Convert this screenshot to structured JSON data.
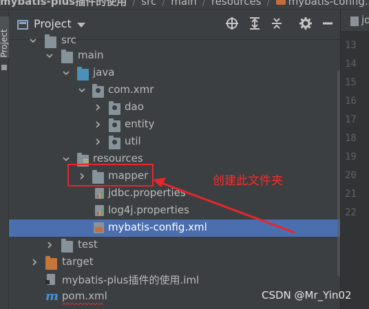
{
  "breadcrumb": {
    "project": "mybatis-plus插件的使用",
    "items": [
      "src",
      "main",
      "resources"
    ],
    "file": "mybatis-config.xml"
  },
  "toolstrip": {
    "project_tab": "Project"
  },
  "panel": {
    "title": "Project",
    "toolbar_icons": [
      "locate-icon",
      "expand-all-icon",
      "collapse-all-icon",
      "gear-icon",
      "hide-icon"
    ]
  },
  "tree": [
    {
      "label": "src",
      "type": "folder",
      "expanded": true
    },
    {
      "label": "main",
      "type": "folder",
      "expanded": true
    },
    {
      "label": "java",
      "type": "source-folder",
      "expanded": true
    },
    {
      "label": "com.xmr",
      "type": "package",
      "expanded": true
    },
    {
      "label": "dao",
      "type": "package",
      "expanded": false
    },
    {
      "label": "entity",
      "type": "package",
      "expanded": false
    },
    {
      "label": "util",
      "type": "package",
      "expanded": false
    },
    {
      "label": "resources",
      "type": "resources-folder",
      "expanded": true
    },
    {
      "label": "mapper",
      "type": "folder",
      "expanded": false
    },
    {
      "label": "jdbc.properties",
      "type": "properties-file"
    },
    {
      "label": "log4j.properties",
      "type": "properties-file"
    },
    {
      "label": "mybatis-config.xml",
      "type": "xml-file",
      "selected": true
    },
    {
      "label": "test",
      "type": "folder",
      "expanded": false
    },
    {
      "label": "target",
      "type": "excluded-folder",
      "expanded": false
    },
    {
      "label": "mybatis-plus插件的使用.iml",
      "type": "iml-file"
    },
    {
      "label": "pom.xml",
      "type": "maven-file"
    }
  ],
  "editor": {
    "tab_label": "jd",
    "line_numbers": [
      "13",
      "14",
      "15",
      "16",
      "17",
      "18",
      "19",
      "20",
      "21",
      "22"
    ]
  },
  "annotation": {
    "text": "创建此文件夹",
    "color": "#e8262b"
  },
  "watermark": "CSDN @Mr_Yin02",
  "colors": {
    "selection": "#4b6eaf",
    "panel_bg": "#3c3f41",
    "editor_bg": "#2b2b2b"
  }
}
